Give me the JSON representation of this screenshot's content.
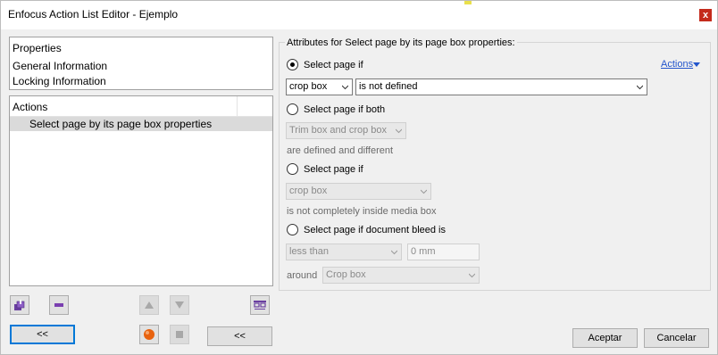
{
  "window": {
    "title": "Enfocus Action List Editor - Ejemplo",
    "close_label": "x"
  },
  "properties_panel": {
    "header": "Properties",
    "items": [
      "General Information",
      "Locking Information"
    ]
  },
  "actions_panel": {
    "header": "Actions",
    "selected_item": "Select page by its page box properties"
  },
  "attributes": {
    "legend": "Attributes for Select page by its page box properties:",
    "actions_link": "Actions",
    "option1": {
      "label": "Select page if",
      "selected": true,
      "box_value": "crop box",
      "condition_value": "is not defined"
    },
    "option2": {
      "label": "Select page if both",
      "selected": false,
      "box_value": "Trim box and crop box",
      "note": "are defined and different"
    },
    "option3": {
      "label": "Select page if",
      "selected": false,
      "box_value": "crop box",
      "note": "is not completely inside media box"
    },
    "option4": {
      "label": "Select page if document bleed is",
      "selected": false,
      "comparison_value": "less than",
      "amount_value": "0 mm",
      "around_label": "around",
      "around_value": "Crop box"
    }
  },
  "toolbar": {
    "collapse_left_label": "<<",
    "collapse_right_label": "<<"
  },
  "footer": {
    "accept_label": "Aceptar",
    "cancel_label": "Cancelar"
  },
  "colors": {
    "accent": "#0078d7",
    "link": "#2255cc",
    "close": "#c42b1c"
  }
}
